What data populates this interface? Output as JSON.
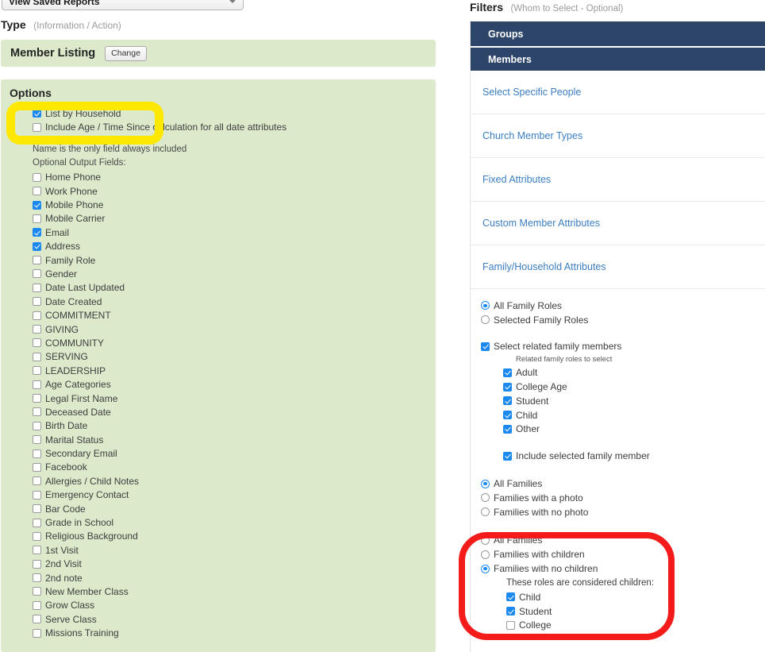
{
  "saved_reports": {
    "selected": "View Saved Reports",
    "caret_icon": "chevron-down-icon"
  },
  "type_section": {
    "label": "Type",
    "hint": "(Information / Action)"
  },
  "member_listing": {
    "title": "Member Listing",
    "change_label": "Change"
  },
  "options": {
    "title": "Options",
    "highlight_color": "#ffe800",
    "top_checkboxes": [
      {
        "label": "List by Household",
        "checked": true
      },
      {
        "label": "Include Age / Time Since calculation for all date attributes",
        "checked": false
      }
    ],
    "note_1": "Name is the only field always included",
    "note_2": "Optional Output Fields:",
    "fields": [
      {
        "label": "Home Phone",
        "checked": false
      },
      {
        "label": "Work Phone",
        "checked": false
      },
      {
        "label": "Mobile Phone",
        "checked": true
      },
      {
        "label": "Mobile Carrier",
        "checked": false
      },
      {
        "label": "Email",
        "checked": true
      },
      {
        "label": "Address",
        "checked": true
      },
      {
        "label": "Family Role",
        "checked": false
      },
      {
        "label": "Gender",
        "checked": false
      },
      {
        "label": "Date Last Updated",
        "checked": false
      },
      {
        "label": "Date Created",
        "checked": false
      },
      {
        "label": "COMMITMENT",
        "checked": false
      },
      {
        "label": "GIVING",
        "checked": false
      },
      {
        "label": "COMMUNITY",
        "checked": false
      },
      {
        "label": "SERVING",
        "checked": false
      },
      {
        "label": "LEADERSHIP",
        "checked": false
      },
      {
        "label": "Age Categories",
        "checked": false
      },
      {
        "label": "Legal First Name",
        "checked": false
      },
      {
        "label": "Deceased Date",
        "checked": false
      },
      {
        "label": "Birth Date",
        "checked": false
      },
      {
        "label": "Marital Status",
        "checked": false
      },
      {
        "label": "Secondary Email",
        "checked": false
      },
      {
        "label": "Facebook",
        "checked": false
      },
      {
        "label": "Allergies / Child Notes",
        "checked": false
      },
      {
        "label": "Emergency Contact",
        "checked": false
      },
      {
        "label": "Bar Code",
        "checked": false
      },
      {
        "label": "Grade in School",
        "checked": false
      },
      {
        "label": "Religious Background",
        "checked": false
      },
      {
        "label": "1st Visit",
        "checked": false
      },
      {
        "label": "2nd Visit",
        "checked": false
      },
      {
        "label": "2nd note",
        "checked": false
      },
      {
        "label": "New Member Class",
        "checked": false
      },
      {
        "label": "Grow Class",
        "checked": false
      },
      {
        "label": "Serve Class",
        "checked": false
      },
      {
        "label": "Missions Training",
        "checked": false
      }
    ]
  },
  "filters": {
    "label": "Filters",
    "hint": "(Whom to Select - Optional)",
    "header_color": "#2c4569",
    "link_color": "#3b7dc0",
    "sections": [
      {
        "label": "Groups"
      },
      {
        "label": "Members"
      }
    ],
    "links": [
      {
        "label": "Select Specific People"
      },
      {
        "label": "Church Member Types"
      },
      {
        "label": "Fixed Attributes"
      },
      {
        "label": "Custom Member Attributes"
      },
      {
        "label": "Family/Household Attributes"
      }
    ],
    "family_roles": {
      "options": [
        {
          "label": "All Family Roles",
          "selected": true
        },
        {
          "label": "Selected Family Roles",
          "selected": false
        }
      ]
    },
    "related_family": {
      "label": "Select related family members",
      "checked": true,
      "note": "Related family roles to select",
      "roles": [
        {
          "label": "Adult",
          "checked": true
        },
        {
          "label": "College Age",
          "checked": true
        },
        {
          "label": "Student",
          "checked": true
        },
        {
          "label": "Child",
          "checked": true
        },
        {
          "label": "Other",
          "checked": true
        }
      ],
      "include_selected": {
        "label": "Include selected family member",
        "checked": true
      }
    },
    "photo_filter": {
      "options": [
        {
          "label": "All Families",
          "selected": true
        },
        {
          "label": "Families with a photo",
          "selected": false
        },
        {
          "label": "Families with no photo",
          "selected": false
        }
      ]
    },
    "children_filter": {
      "highlight_color": "#f41b1b",
      "options": [
        {
          "label": "All Families",
          "selected": false
        },
        {
          "label": "Families with children",
          "selected": false
        },
        {
          "label": "Families with no children",
          "selected": true
        }
      ],
      "note": "These roles are considered children:",
      "roles": [
        {
          "label": "Child",
          "checked": true
        },
        {
          "label": "Student",
          "checked": true
        },
        {
          "label": "College",
          "checked": false
        }
      ]
    }
  }
}
